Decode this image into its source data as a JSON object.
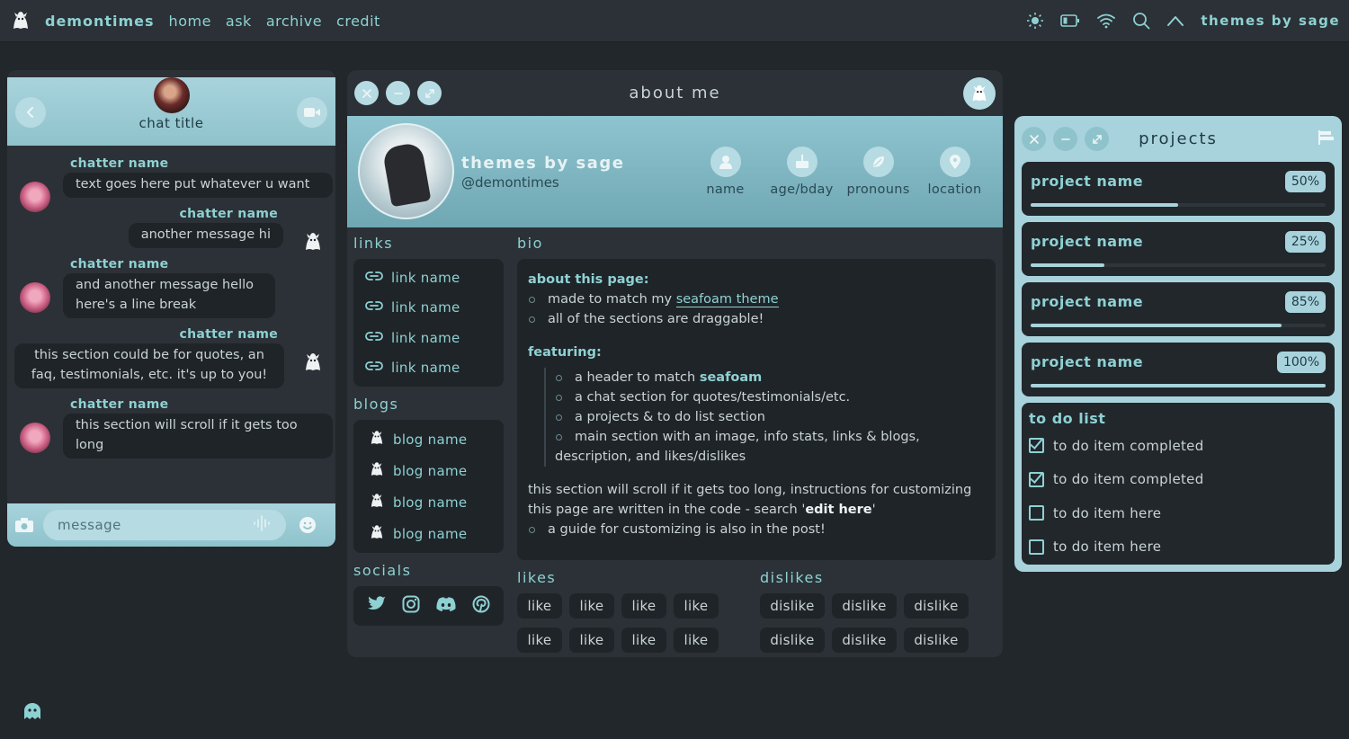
{
  "topbar": {
    "site_name": "demontimes",
    "nav": [
      "home",
      "ask",
      "archive",
      "credit"
    ],
    "author": "themes by sage",
    "icons": [
      "sun-icon",
      "battery-icon",
      "wifi-icon",
      "search-icon",
      "chevron-up-icon"
    ]
  },
  "chat": {
    "title": "chat title",
    "messages": [
      {
        "name": "chatter name",
        "text": "text goes here put whatever u want",
        "side": "left"
      },
      {
        "name": "chatter name",
        "text": "another message hi",
        "side": "right"
      },
      {
        "name": "chatter name",
        "text": "and another message hello here's a line break",
        "side": "left"
      },
      {
        "name": "chatter name",
        "text": "this section could be for quotes, an faq, testimonials, etc. it's up to you!",
        "side": "right"
      },
      {
        "name": "chatter name",
        "text": "this section will scroll if it gets too long",
        "side": "left"
      }
    ],
    "input_placeholder": "message"
  },
  "about": {
    "window_title": "about me",
    "profile_name": "themes by sage",
    "handle": "@demontimes",
    "stats": [
      "name",
      "age/bday",
      "pronouns",
      "location"
    ],
    "links_heading": "links",
    "links": [
      "link name",
      "link name",
      "link name",
      "link name"
    ],
    "blogs_heading": "blogs",
    "blogs": [
      "blog name",
      "blog name",
      "blog name",
      "blog name"
    ],
    "socials_heading": "socials",
    "socials": [
      "twitter-icon",
      "instagram-icon",
      "discord-icon",
      "pinterest-icon"
    ],
    "bio_heading": "bio",
    "bio": {
      "about_heading": "about this page:",
      "about_item1_pre": "made to match my ",
      "about_item1_link": "seafoam theme",
      "about_item2": "all of the sections are draggable!",
      "featuring_heading": "featuring:",
      "feat1_pre": "a header to match ",
      "feat1_bold": "seafoam",
      "feat2": "a chat section for quotes/testimonials/etc.",
      "feat3": "a projects & to do list section",
      "feat4": "main section with an image, info stats, links & blogs,",
      "feat4_cont": "description, and likes/dislikes",
      "scroll_pre": "this section will scroll if it gets too long, instructions for customizing this page are written in the code - search '",
      "scroll_bold": "edit here",
      "scroll_post": "'",
      "guide": "a guide for customizing is also in the post!"
    },
    "likes_heading": "likes",
    "likes": [
      "like",
      "like",
      "like",
      "like",
      "like",
      "like",
      "like",
      "like"
    ],
    "dislikes_heading": "dislikes",
    "dislikes": [
      "dislike",
      "dislike",
      "dislike",
      "dislike",
      "dislike",
      "dislike"
    ]
  },
  "projects": {
    "window_title": "projects",
    "items": [
      {
        "name": "project name",
        "percent_label": "50%",
        "progress": 0.5
      },
      {
        "name": "project name",
        "percent_label": "25%",
        "progress": 0.25
      },
      {
        "name": "project name",
        "percent_label": "85%",
        "progress": 0.85
      },
      {
        "name": "project name",
        "percent_label": "100%",
        "progress": 1.0
      }
    ],
    "todo_heading": "to do list",
    "todo": [
      {
        "text": "to do item completed",
        "done": true
      },
      {
        "text": "to do item completed",
        "done": true
      },
      {
        "text": "to do item here",
        "done": false
      },
      {
        "text": "to do item here",
        "done": false
      }
    ]
  },
  "colors": {
    "accent": "#8ed1d3",
    "panel": "#2b3136",
    "background": "#22272c",
    "seafoam": "#a8d3dc"
  }
}
